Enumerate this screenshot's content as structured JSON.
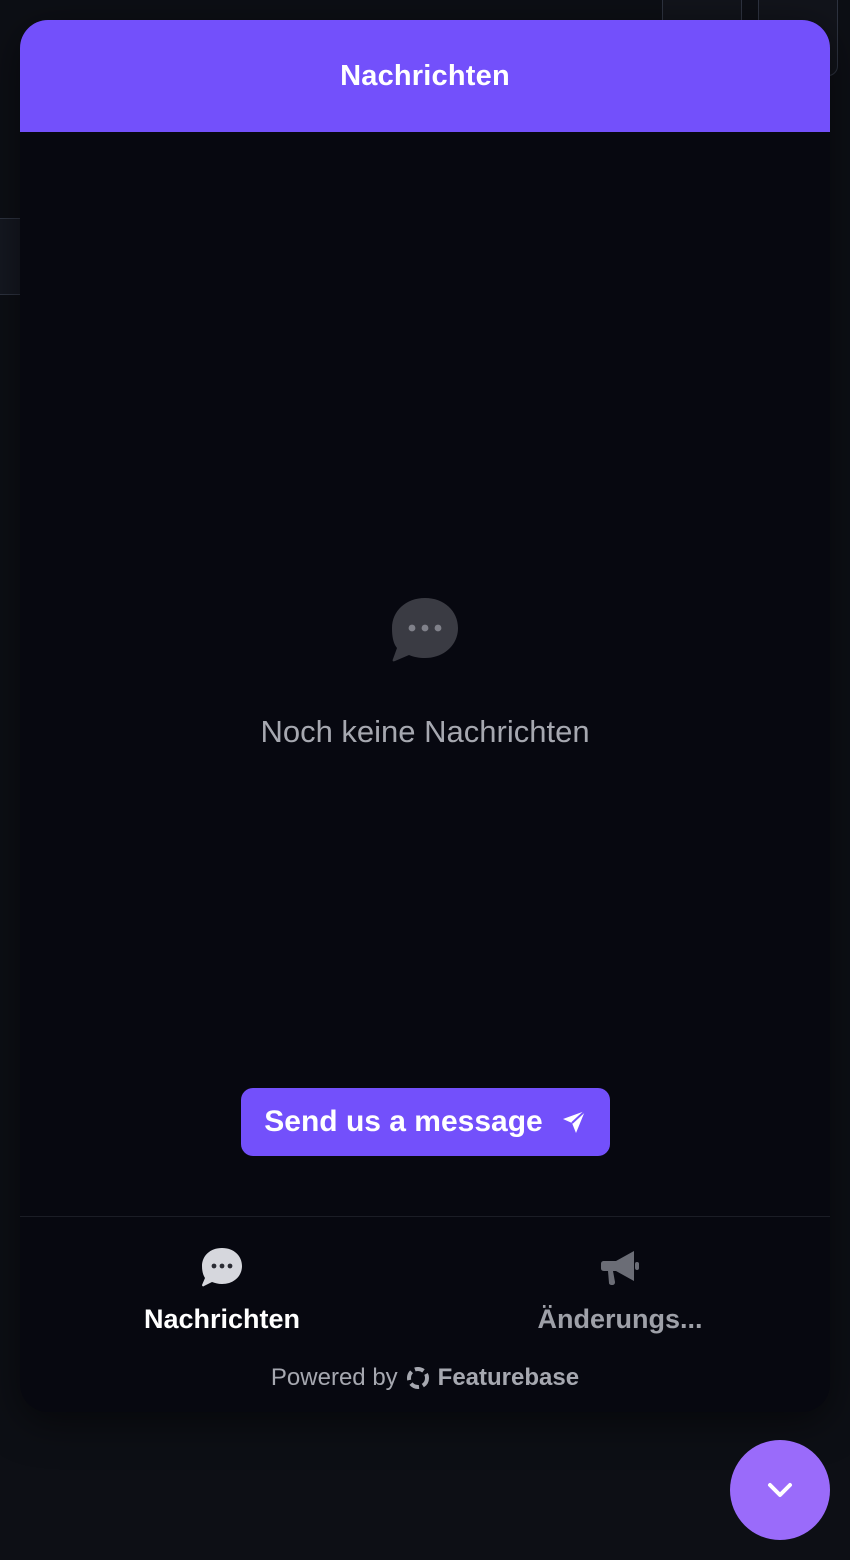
{
  "header": {
    "title": "Nachrichten"
  },
  "empty_state": {
    "icon": "chat-bubble-icon",
    "text": "Noch keine Nachrichten"
  },
  "send_button": {
    "label": "Send us a message",
    "icon": "paper-plane-icon"
  },
  "nav": {
    "items": [
      {
        "label": "Nachrichten",
        "icon": "chat-bubble-icon",
        "active": true
      },
      {
        "label": "Änderungs...",
        "icon": "megaphone-icon",
        "active": false
      }
    ]
  },
  "footer": {
    "powered_prefix": "Powered by",
    "brand": "Featurebase"
  },
  "toggle": {
    "icon": "chevron-down-icon"
  },
  "colors": {
    "accent": "#7350fb",
    "toggle": "#9a6bfa",
    "background": "#070810",
    "text_muted": "#a6a8b0"
  }
}
